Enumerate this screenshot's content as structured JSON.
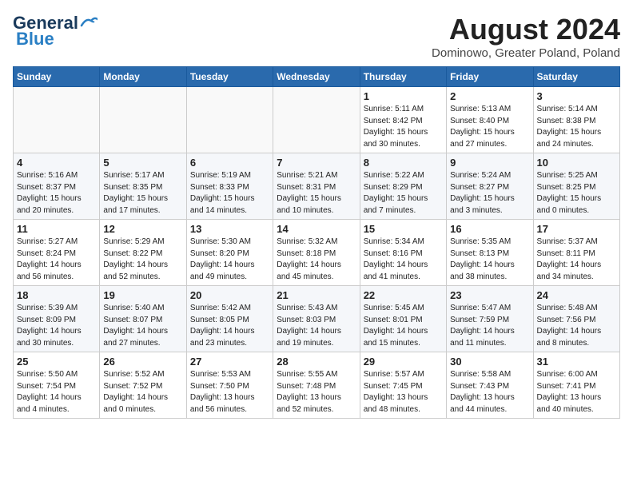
{
  "header": {
    "logo_general": "General",
    "logo_blue": "Blue",
    "month_year": "August 2024",
    "location": "Dominowo, Greater Poland, Poland"
  },
  "days_of_week": [
    "Sunday",
    "Monday",
    "Tuesday",
    "Wednesday",
    "Thursday",
    "Friday",
    "Saturday"
  ],
  "weeks": [
    [
      {
        "day": "",
        "info": ""
      },
      {
        "day": "",
        "info": ""
      },
      {
        "day": "",
        "info": ""
      },
      {
        "day": "",
        "info": ""
      },
      {
        "day": "1",
        "info": "Sunrise: 5:11 AM\nSunset: 8:42 PM\nDaylight: 15 hours\nand 30 minutes."
      },
      {
        "day": "2",
        "info": "Sunrise: 5:13 AM\nSunset: 8:40 PM\nDaylight: 15 hours\nand 27 minutes."
      },
      {
        "day": "3",
        "info": "Sunrise: 5:14 AM\nSunset: 8:38 PM\nDaylight: 15 hours\nand 24 minutes."
      }
    ],
    [
      {
        "day": "4",
        "info": "Sunrise: 5:16 AM\nSunset: 8:37 PM\nDaylight: 15 hours\nand 20 minutes."
      },
      {
        "day": "5",
        "info": "Sunrise: 5:17 AM\nSunset: 8:35 PM\nDaylight: 15 hours\nand 17 minutes."
      },
      {
        "day": "6",
        "info": "Sunrise: 5:19 AM\nSunset: 8:33 PM\nDaylight: 15 hours\nand 14 minutes."
      },
      {
        "day": "7",
        "info": "Sunrise: 5:21 AM\nSunset: 8:31 PM\nDaylight: 15 hours\nand 10 minutes."
      },
      {
        "day": "8",
        "info": "Sunrise: 5:22 AM\nSunset: 8:29 PM\nDaylight: 15 hours\nand 7 minutes."
      },
      {
        "day": "9",
        "info": "Sunrise: 5:24 AM\nSunset: 8:27 PM\nDaylight: 15 hours\nand 3 minutes."
      },
      {
        "day": "10",
        "info": "Sunrise: 5:25 AM\nSunset: 8:25 PM\nDaylight: 15 hours\nand 0 minutes."
      }
    ],
    [
      {
        "day": "11",
        "info": "Sunrise: 5:27 AM\nSunset: 8:24 PM\nDaylight: 14 hours\nand 56 minutes."
      },
      {
        "day": "12",
        "info": "Sunrise: 5:29 AM\nSunset: 8:22 PM\nDaylight: 14 hours\nand 52 minutes."
      },
      {
        "day": "13",
        "info": "Sunrise: 5:30 AM\nSunset: 8:20 PM\nDaylight: 14 hours\nand 49 minutes."
      },
      {
        "day": "14",
        "info": "Sunrise: 5:32 AM\nSunset: 8:18 PM\nDaylight: 14 hours\nand 45 minutes."
      },
      {
        "day": "15",
        "info": "Sunrise: 5:34 AM\nSunset: 8:16 PM\nDaylight: 14 hours\nand 41 minutes."
      },
      {
        "day": "16",
        "info": "Sunrise: 5:35 AM\nSunset: 8:13 PM\nDaylight: 14 hours\nand 38 minutes."
      },
      {
        "day": "17",
        "info": "Sunrise: 5:37 AM\nSunset: 8:11 PM\nDaylight: 14 hours\nand 34 minutes."
      }
    ],
    [
      {
        "day": "18",
        "info": "Sunrise: 5:39 AM\nSunset: 8:09 PM\nDaylight: 14 hours\nand 30 minutes."
      },
      {
        "day": "19",
        "info": "Sunrise: 5:40 AM\nSunset: 8:07 PM\nDaylight: 14 hours\nand 27 minutes."
      },
      {
        "day": "20",
        "info": "Sunrise: 5:42 AM\nSunset: 8:05 PM\nDaylight: 14 hours\nand 23 minutes."
      },
      {
        "day": "21",
        "info": "Sunrise: 5:43 AM\nSunset: 8:03 PM\nDaylight: 14 hours\nand 19 minutes."
      },
      {
        "day": "22",
        "info": "Sunrise: 5:45 AM\nSunset: 8:01 PM\nDaylight: 14 hours\nand 15 minutes."
      },
      {
        "day": "23",
        "info": "Sunrise: 5:47 AM\nSunset: 7:59 PM\nDaylight: 14 hours\nand 11 minutes."
      },
      {
        "day": "24",
        "info": "Sunrise: 5:48 AM\nSunset: 7:56 PM\nDaylight: 14 hours\nand 8 minutes."
      }
    ],
    [
      {
        "day": "25",
        "info": "Sunrise: 5:50 AM\nSunset: 7:54 PM\nDaylight: 14 hours\nand 4 minutes."
      },
      {
        "day": "26",
        "info": "Sunrise: 5:52 AM\nSunset: 7:52 PM\nDaylight: 14 hours\nand 0 minutes."
      },
      {
        "day": "27",
        "info": "Sunrise: 5:53 AM\nSunset: 7:50 PM\nDaylight: 13 hours\nand 56 minutes."
      },
      {
        "day": "28",
        "info": "Sunrise: 5:55 AM\nSunset: 7:48 PM\nDaylight: 13 hours\nand 52 minutes."
      },
      {
        "day": "29",
        "info": "Sunrise: 5:57 AM\nSunset: 7:45 PM\nDaylight: 13 hours\nand 48 minutes."
      },
      {
        "day": "30",
        "info": "Sunrise: 5:58 AM\nSunset: 7:43 PM\nDaylight: 13 hours\nand 44 minutes."
      },
      {
        "day": "31",
        "info": "Sunrise: 6:00 AM\nSunset: 7:41 PM\nDaylight: 13 hours\nand 40 minutes."
      }
    ]
  ]
}
